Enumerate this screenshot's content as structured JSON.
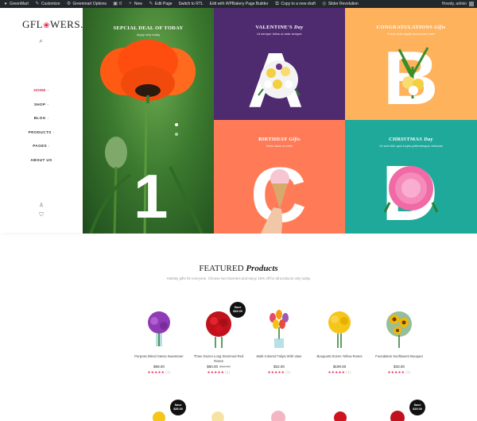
{
  "adminbar": {
    "items": [
      "GreenMart",
      "Customize",
      "Greenmart Options",
      "0",
      "New",
      "Edit Page",
      "Switch to RTL",
      "Edit with WPBakery Page Builder",
      "Copy to a new draft",
      "Slider Revolution"
    ],
    "greeting": "Howdy, admin"
  },
  "logo": {
    "text": "GFL",
    "flower": "❀",
    "text2": "WERS."
  },
  "nav": [
    "HOME",
    "SHOP",
    "BLOG",
    "PRODUCTS",
    "PAGES",
    "ABOUT US"
  ],
  "cart": {
    "count": "0"
  },
  "hero": {
    "title": "SEPCIAL DEAL OF TODAY",
    "subtitle": "Apply only today",
    "number": "1"
  },
  "tiles": {
    "a": {
      "title": "VALENTINE'S",
      "title_italic": "Day",
      "sub": "Ut semper tellus ut ante semper",
      "letter": "A"
    },
    "b": {
      "title": "CONGRATULATIONS",
      "title_italic": "Gifts",
      "sub": "Fusce quis sagitti accumsan enim",
      "letter": "B"
    },
    "c": {
      "title": "BIRTHDAY",
      "title_italic": "Gifts",
      "sub": "Nunc diam ut enim",
      "letter": "C"
    },
    "d": {
      "title": "CHRISTMAS",
      "title_italic": "Day",
      "sub": "Ut sed nibh quis turpis pellentesque vehicula",
      "letter": "D"
    }
  },
  "featured": {
    "title": "FEATURED",
    "title_italic": "Products",
    "subtitle": "Holiday gifts for everyone. Choose two favorites and enjoy 10% off for all products only today"
  },
  "products": [
    {
      "name": "Purpose Blend Stevia Sweetener",
      "price": "$69.00",
      "old": "",
      "stars": "★★★★★",
      "count": "(1)",
      "badge": "",
      "color": "#8e3bb5"
    },
    {
      "name": "Three Dozen Long Stemmed Red Roses",
      "price": "$50.00",
      "old": "$69.00",
      "stars": "★★★★★",
      "count": "(1)",
      "badge": "Save\n$19.00",
      "color": "#d0121f"
    },
    {
      "name": "Multi-Colored Tulips With Vase",
      "price": "$22.00",
      "old": "",
      "stars": "★★★★★",
      "count": "(1)",
      "badge": "",
      "color": "#e64a6b"
    },
    {
      "name": "Bouquets Dozen Yellow Roses",
      "price": "$199.00",
      "old": "",
      "stars": "★★★★★",
      "count": "(1)",
      "badge": "",
      "color": "#f5c518"
    },
    {
      "name": "Foundation Sunflowers Bouquet",
      "price": "$33.00",
      "old": "",
      "stars": "★★★★★",
      "count": "(1)",
      "badge": "",
      "color": "#f2b705"
    }
  ],
  "row2_badges": {
    "first": "Save\n$35.00",
    "last": "Save\n$19.00"
  }
}
